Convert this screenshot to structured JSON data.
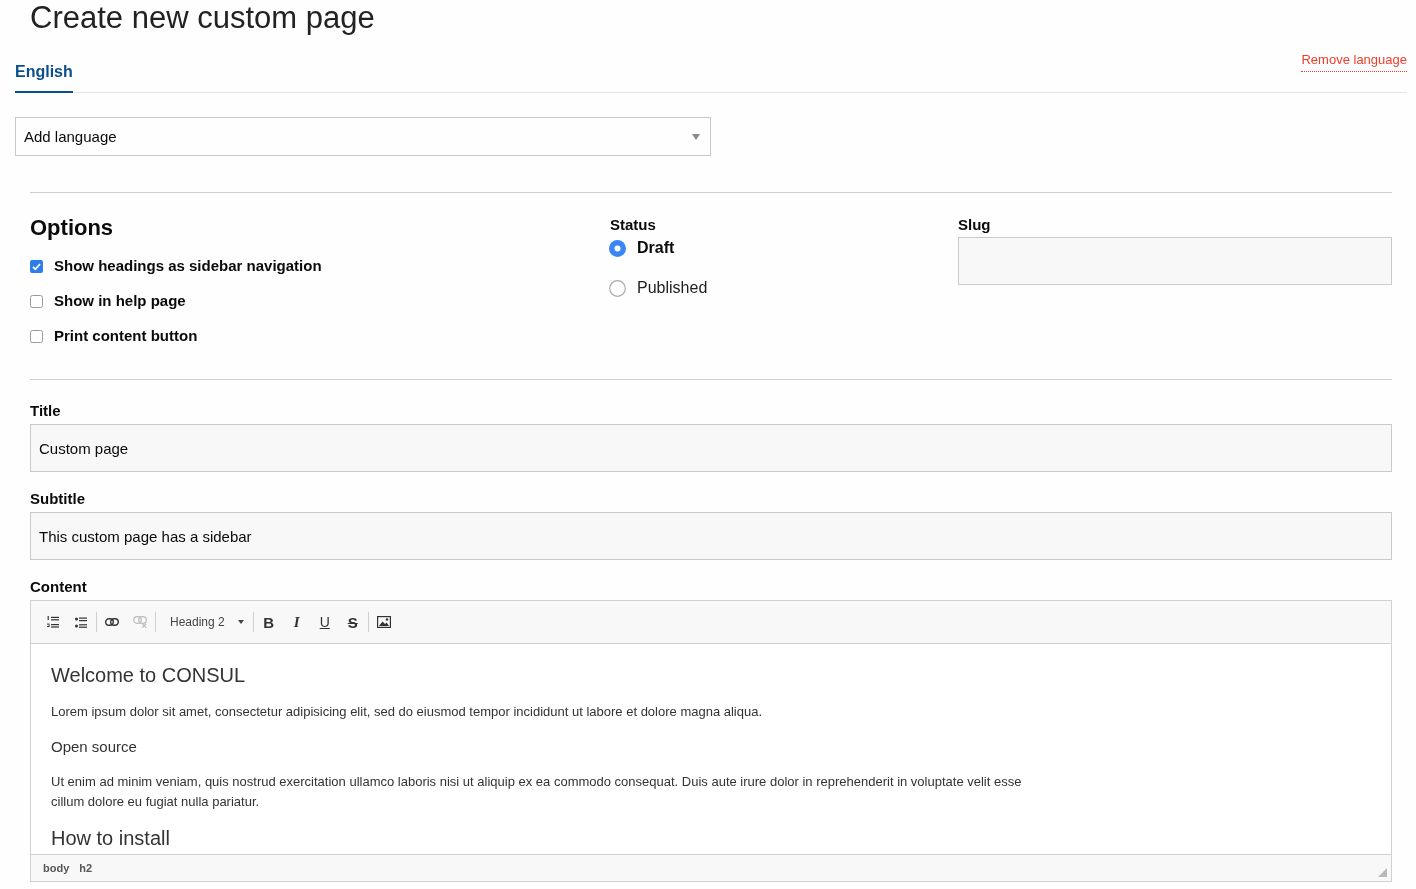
{
  "page": {
    "title": "Create new custom page"
  },
  "language_tabs": {
    "tabs": [
      {
        "label": "English",
        "selected": true
      }
    ],
    "remove_link": "Remove language"
  },
  "add_language_select": {
    "value": "Add language"
  },
  "options": {
    "heading": "Options",
    "checkboxes": [
      {
        "label": "Show headings as sidebar navigation",
        "checked": true
      },
      {
        "label": "Show in help page",
        "checked": false
      },
      {
        "label": "Print content button",
        "checked": false
      }
    ]
  },
  "status": {
    "label": "Status",
    "radios": [
      {
        "label": "Draft",
        "selected": true
      },
      {
        "label": "Published",
        "selected": false
      }
    ]
  },
  "slug": {
    "label": "Slug"
  },
  "title_field": {
    "label": "Title",
    "value": "Custom page"
  },
  "subtitle_field": {
    "label": "Subtitle",
    "value": "This custom page has a sidebar"
  },
  "content": {
    "label": "Content",
    "toolbar": [
      {
        "items": [
          {
            "kind": "numbered-list",
            "disabled": false
          },
          {
            "kind": "bulleted-list",
            "disabled": false
          }
        ]
      },
      {
        "items": [
          {
            "kind": "link",
            "disabled": false
          },
          {
            "kind": "unlink",
            "disabled": true
          }
        ]
      },
      {
        "items": [
          {
            "kind": "format",
            "label": "Heading 2",
            "disabled": false
          }
        ]
      },
      {
        "items": [
          {
            "kind": "bold",
            "label": "B",
            "disabled": false
          },
          {
            "kind": "italic",
            "label": "I",
            "disabled": false
          },
          {
            "kind": "underline",
            "label": "U",
            "disabled": false
          },
          {
            "kind": "strike",
            "label": "S",
            "disabled": false
          }
        ]
      },
      {
        "items": [
          {
            "kind": "image",
            "disabled": false
          }
        ]
      }
    ],
    "blocks": [
      {
        "kind": "h2",
        "text": "Welcome to CONSUL"
      },
      {
        "kind": "p",
        "text": "Lorem ipsum dolor sit amet, consectetur adipisicing elit, sed do eiusmod tempor incididunt ut labore et dolore magna aliqua."
      },
      {
        "kind": "h3",
        "text": "Open source"
      },
      {
        "kind": "p",
        "text": "Ut enim ad minim veniam, quis nostrud exercitation ullamco laboris nisi ut aliquip ex ea commodo consequat. Duis aute irure dolor in reprehenderit in voluptate velit esse cillum dolore eu fugiat nulla pariatur."
      },
      {
        "kind": "h2",
        "text": "How to install"
      }
    ],
    "element_path": [
      "body",
      "h2"
    ]
  }
}
